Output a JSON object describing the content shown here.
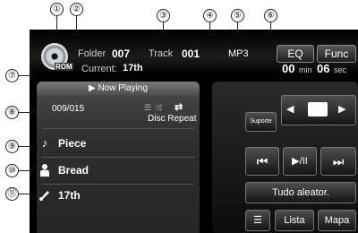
{
  "callouts": [
    "①",
    "②",
    "③",
    "④",
    "⑤",
    "⑥",
    "⑦",
    "⑧",
    "⑨",
    "⑩",
    "⑪"
  ],
  "header": {
    "disc_label": "ROM",
    "folder_label": "Folder",
    "folder_value": "007",
    "track_label": "Track",
    "track_value": "001",
    "format": "MP3",
    "eq_label": "EQ",
    "func_label": "Func",
    "time_min": "00",
    "time_min_unit": "min",
    "time_sec": "06",
    "time_sec_unit": "sec",
    "current_label": "Current:",
    "current_value": "17th"
  },
  "now_playing": {
    "title": "▶  Now Playing",
    "count": "009/015",
    "repeat_icons": "☰ ⤨",
    "repeat_glyph": "⇄",
    "repeat_label": "Disc Repeat",
    "song_icon": "♪",
    "song": "Piece",
    "artist_icon": "person-icon",
    "artist": "Bread",
    "album_icon": "disc-icon",
    "album": "17th"
  },
  "controls": {
    "suporte": "Suporte",
    "prev_folder": "◀",
    "next_folder": "▶",
    "prev_track": "⏮",
    "play_pause": "▶/II",
    "next_track": "⏭",
    "random": "Tudo aleator.",
    "list_icon": "☰",
    "lista": "Lista",
    "mapa": "Mapa"
  }
}
